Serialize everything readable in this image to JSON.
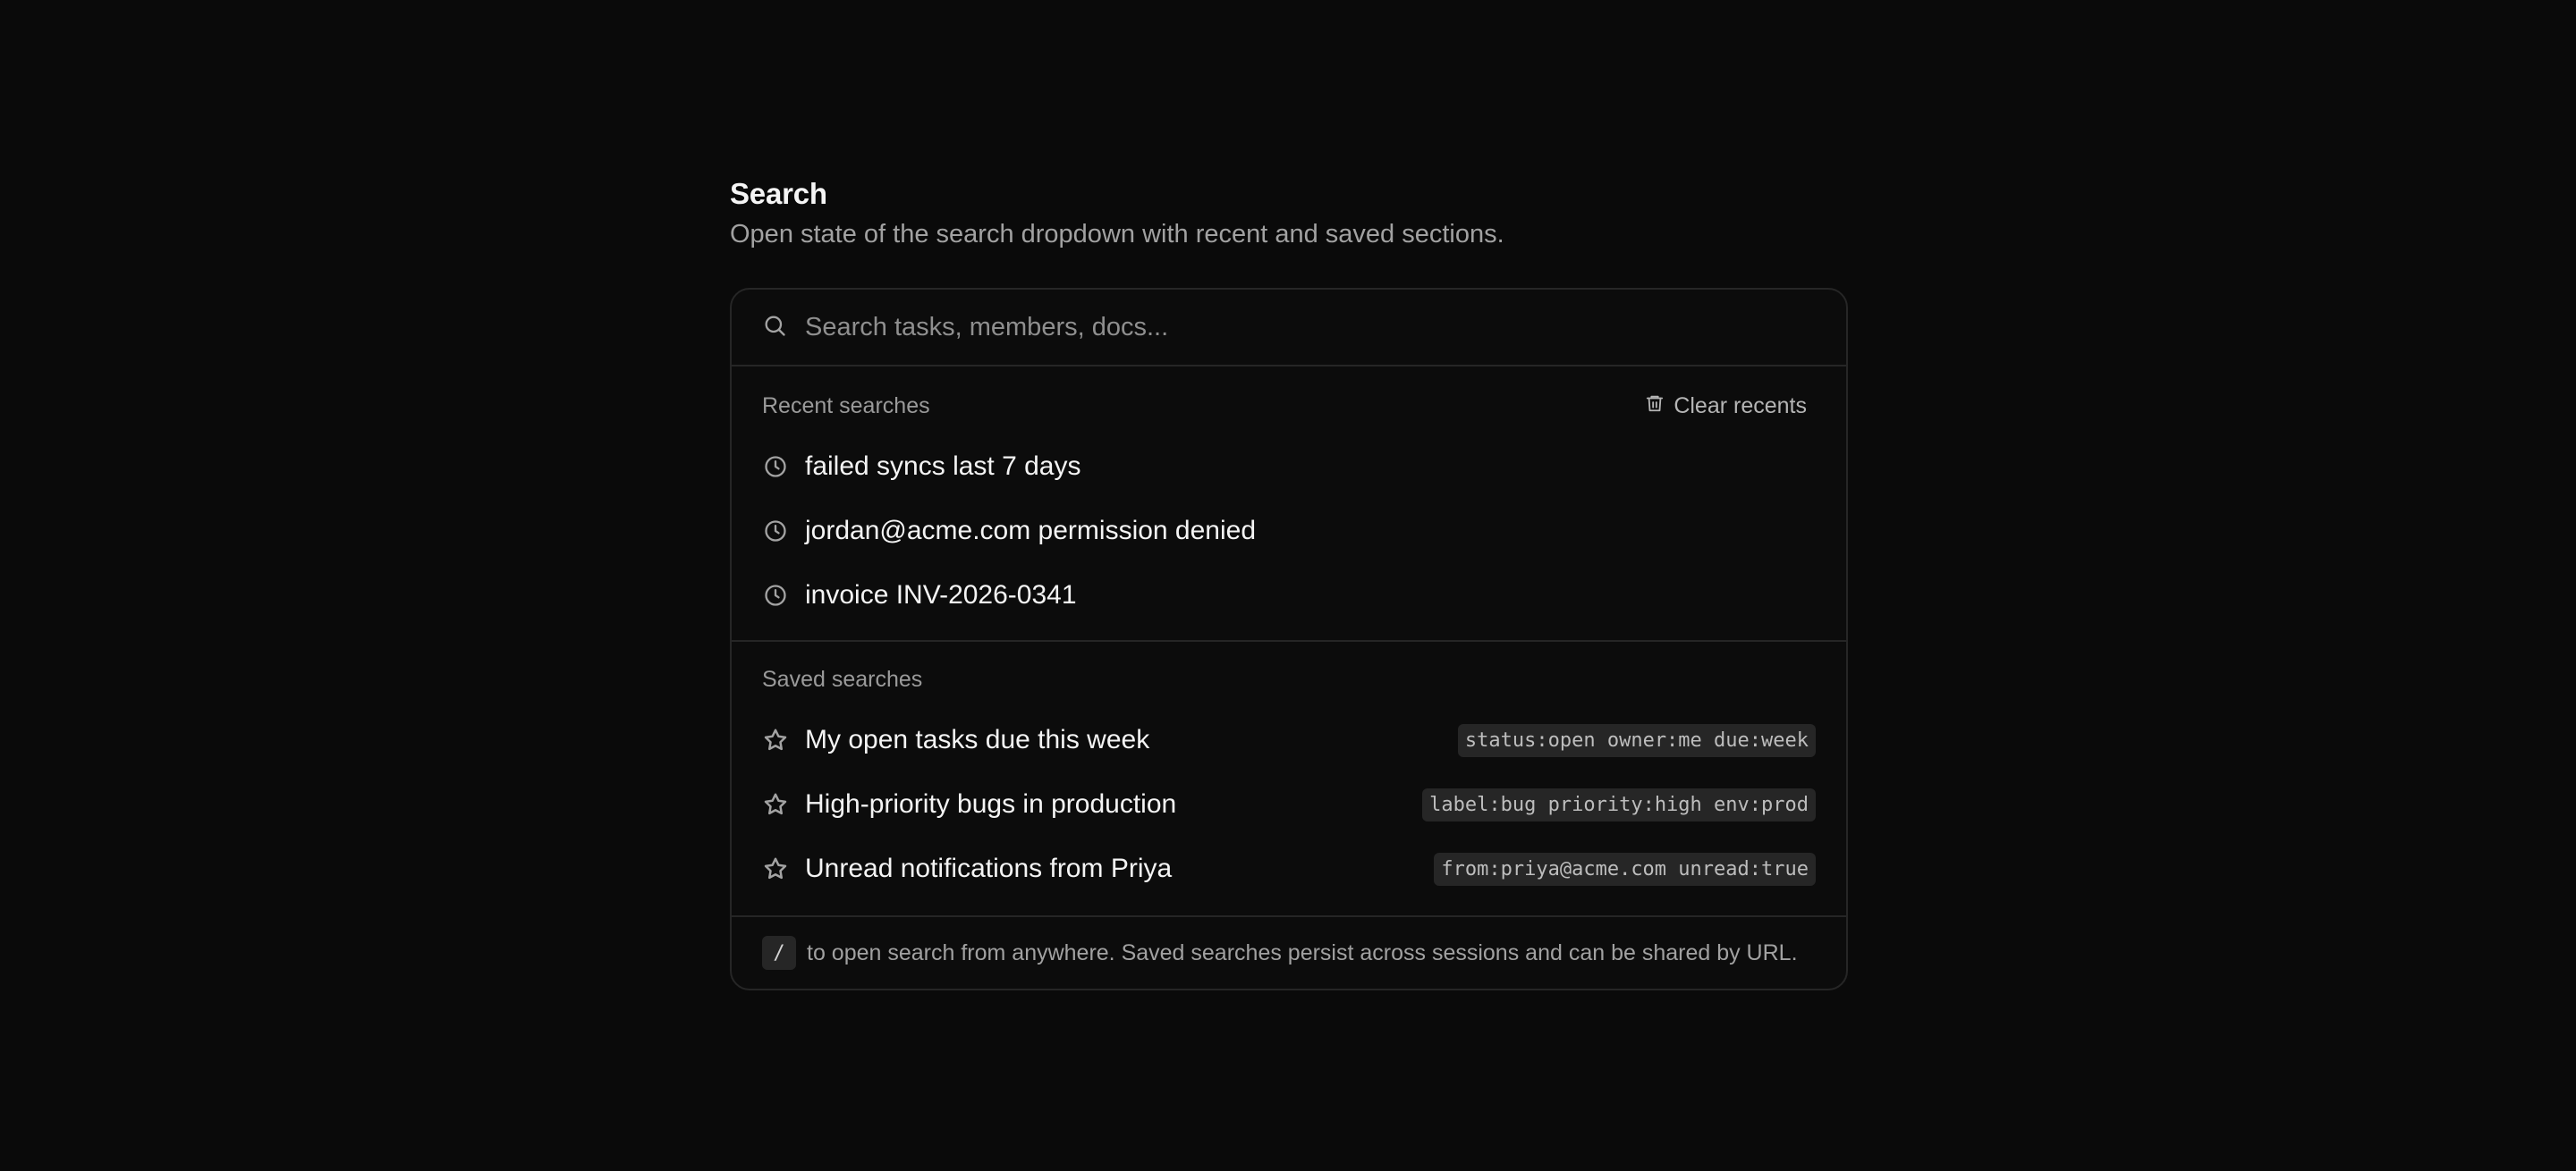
{
  "header": {
    "title": "Search",
    "subtitle": "Open state of the search dropdown with recent and saved sections."
  },
  "search": {
    "placeholder": "Search tasks, members, docs...",
    "value": ""
  },
  "recent": {
    "label": "Recent searches",
    "clear_label": "Clear recents",
    "items": [
      {
        "text": "failed syncs last 7 days",
        "icon": "clock-icon"
      },
      {
        "text": "jordan@acme.com permission denied",
        "icon": "clock-icon"
      },
      {
        "text": "invoice INV-2026-0341",
        "icon": "clock-icon"
      }
    ]
  },
  "saved": {
    "label": "Saved searches",
    "items": [
      {
        "text": "My open tasks due this week",
        "query": "status:open owner:me due:week",
        "icon": "star-icon"
      },
      {
        "text": "High-priority bugs in production",
        "query": "label:bug priority:high env:prod",
        "icon": "star-icon"
      },
      {
        "text": "Unread notifications from Priya",
        "query": "from:priya@acme.com unread:true",
        "icon": "star-icon"
      }
    ]
  },
  "footer": {
    "shortcut_key": "/",
    "hint": "to open search from anywhere. Saved searches persist across sessions and can be shared by URL."
  },
  "colors": {
    "background": "#0a0a0a",
    "border": "#262626",
    "text": "#f4f4f4",
    "muted": "#a1a1a1",
    "chip": "#262626"
  }
}
